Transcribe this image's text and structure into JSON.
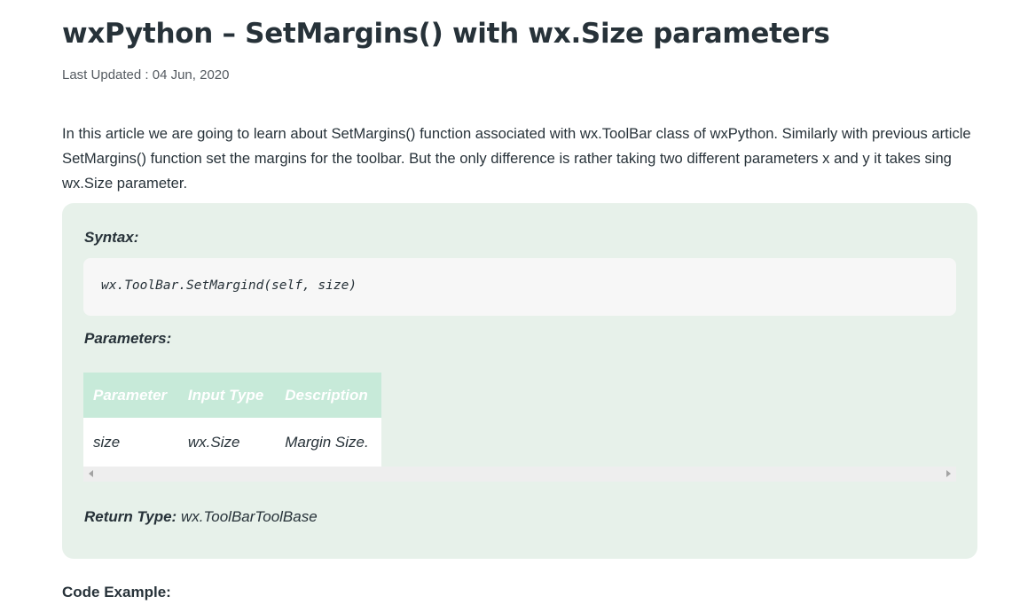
{
  "article": {
    "title": "wxPython – SetMargins() with wx.Size parameters",
    "last_updated": "Last Updated : 04 Jun, 2020",
    "intro": "In this article we are going to learn about SetMargins() function associated with wx.ToolBar class of wxPython. Similarly with previous article SetMargins() function set the margins for the toolbar. But the only difference is rather taking two different parameters x and y it takes sing wx.Size parameter."
  },
  "box": {
    "syntax_label": "Syntax:",
    "syntax_code": "wx.ToolBar.SetMargind(self, size)",
    "parameters_label": "Parameters:",
    "table": {
      "headers": [
        "Parameter",
        "Input Type",
        "Description"
      ],
      "rows": [
        [
          "size",
          "wx.Size",
          "Margin Size."
        ]
      ]
    },
    "return_label": "Return Type:",
    "return_value": "wx.ToolBarToolBase",
    "colors": {
      "box_bg": "#e7f1ea",
      "table_header_bg": "#c7ead9",
      "code_bg": "#f7f7f7"
    }
  },
  "code_example_label": "Code Example:"
}
